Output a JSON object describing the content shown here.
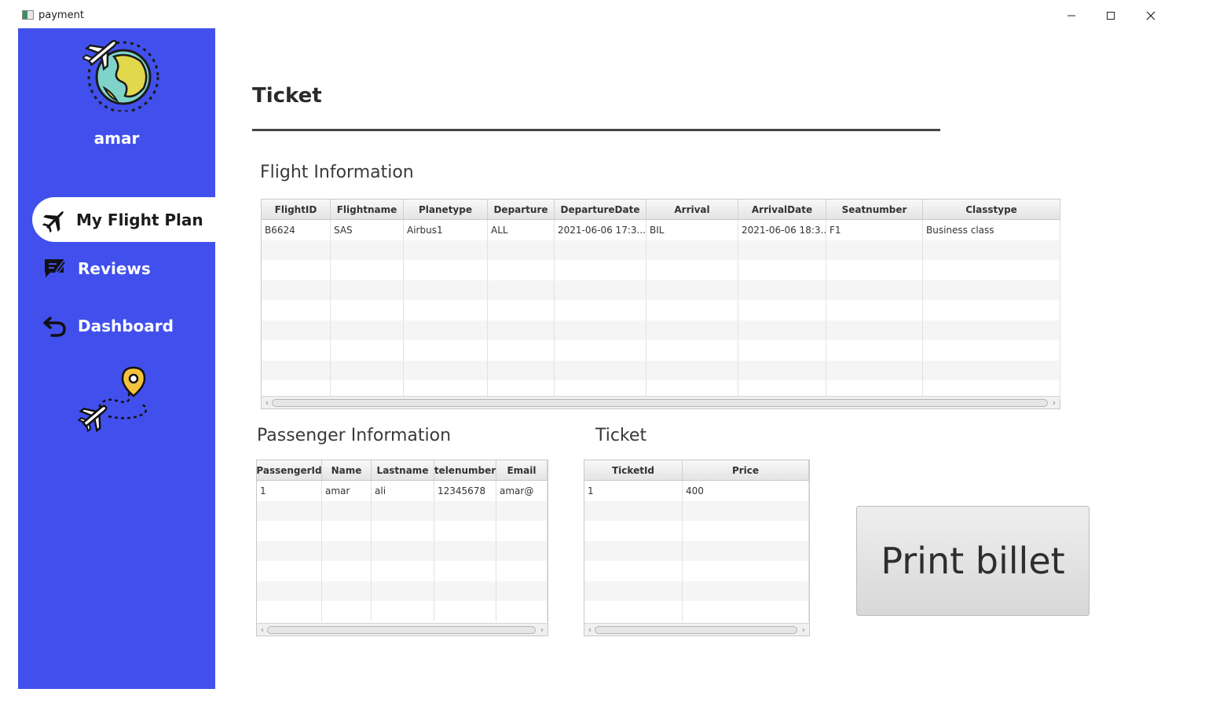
{
  "window": {
    "title": "payment"
  },
  "sidebar": {
    "user_name": "amar",
    "nav": [
      {
        "label": "My Flight Plan",
        "icon": "airplane-icon",
        "active": true
      },
      {
        "label": "Reviews",
        "icon": "chat-edit-icon",
        "active": false
      },
      {
        "label": "Dashboard",
        "icon": "back-arrow-icon",
        "active": false
      }
    ],
    "colors": {
      "background": "#4150ec",
      "active_bg": "#ffffff"
    }
  },
  "main": {
    "title": "Ticket",
    "flight_info": {
      "label": "Flight Information",
      "columns": [
        "FlightID",
        "Flightname",
        "Planetype",
        "Departure",
        "DepartureDate",
        "Arrival",
        "ArrivalDate",
        "Seatnumber",
        "Classtype"
      ],
      "rows": [
        [
          "B6624",
          "SAS",
          "Airbus1",
          "ALL",
          "2021-06-06 17:3...",
          "BIL",
          "2021-06-06 18:3...",
          "F1",
          "Business class"
        ]
      ]
    },
    "passenger_info": {
      "label": "Passenger Information",
      "columns": [
        "PassengerId",
        "Name",
        "Lastname",
        "telenumber",
        "Email"
      ],
      "rows": [
        [
          "1",
          "amar",
          "ali",
          "12345678",
          "amar@"
        ]
      ]
    },
    "ticket_info": {
      "label": "Ticket",
      "columns": [
        "TicketId",
        "Price"
      ],
      "rows": [
        [
          "1",
          "400"
        ]
      ]
    },
    "print_button": "Print billet"
  }
}
